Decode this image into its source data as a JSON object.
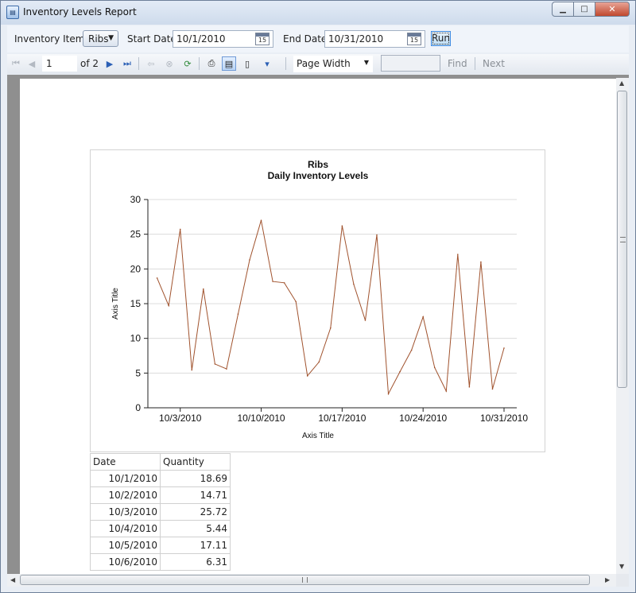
{
  "window": {
    "title": "Inventory Levels Report",
    "app_icon": "report-icon"
  },
  "params": {
    "item_label": "Inventory Item:",
    "item_value": "Ribs",
    "start_label": "Start Date",
    "start_value": "10/1/2010",
    "end_label": "End Date",
    "end_value": "10/31/2010",
    "calendar_day": "15",
    "run_label": "Run"
  },
  "toolbar": {
    "page_current": "1",
    "page_of": "of",
    "page_total": "2",
    "zoom": "Page Width",
    "find_label": "Find",
    "next_label": "Next"
  },
  "report": {
    "table_headers": [
      "Date",
      "Quantity"
    ],
    "table_rows": [
      [
        "10/1/2010",
        "18.69"
      ],
      [
        "10/2/2010",
        "14.71"
      ],
      [
        "10/3/2010",
        "25.72"
      ],
      [
        "10/4/2010",
        "5.44"
      ],
      [
        "10/5/2010",
        "17.11"
      ],
      [
        "10/6/2010",
        "6.31"
      ]
    ]
  },
  "chart_data": {
    "type": "line",
    "title": "Ribs",
    "subtitle": "Daily Inventory Levels",
    "xlabel": "Axis Title",
    "ylabel": "Axis Title",
    "ylim": [
      0,
      30
    ],
    "yticks": [
      0,
      5,
      10,
      15,
      20,
      25,
      30
    ],
    "xtick_labels": [
      "10/3/2010",
      "10/10/2010",
      "10/17/2010",
      "10/24/2010",
      "10/31/2010"
    ],
    "xtick_days": [
      3,
      10,
      17,
      24,
      31
    ],
    "xlim": [
      0.2,
      32.1
    ],
    "grid": true,
    "line_color": "#a0522d",
    "x": [
      1,
      2,
      3,
      4,
      5,
      6,
      7,
      8,
      9,
      10,
      11,
      12,
      13,
      14,
      15,
      16,
      17,
      18,
      19,
      20,
      21,
      22,
      23,
      24,
      25,
      26,
      27,
      28,
      29,
      30,
      31
    ],
    "values": [
      18.69,
      14.71,
      25.72,
      5.44,
      17.11,
      6.31,
      5.6,
      13.5,
      21.3,
      27.0,
      18.2,
      18.0,
      15.3,
      4.6,
      6.6,
      11.5,
      26.2,
      17.8,
      12.6,
      24.9,
      2.0,
      5.2,
      8.3,
      13.1,
      5.8,
      2.4,
      22.1,
      3.0,
      21.0,
      2.7,
      8.6
    ]
  }
}
